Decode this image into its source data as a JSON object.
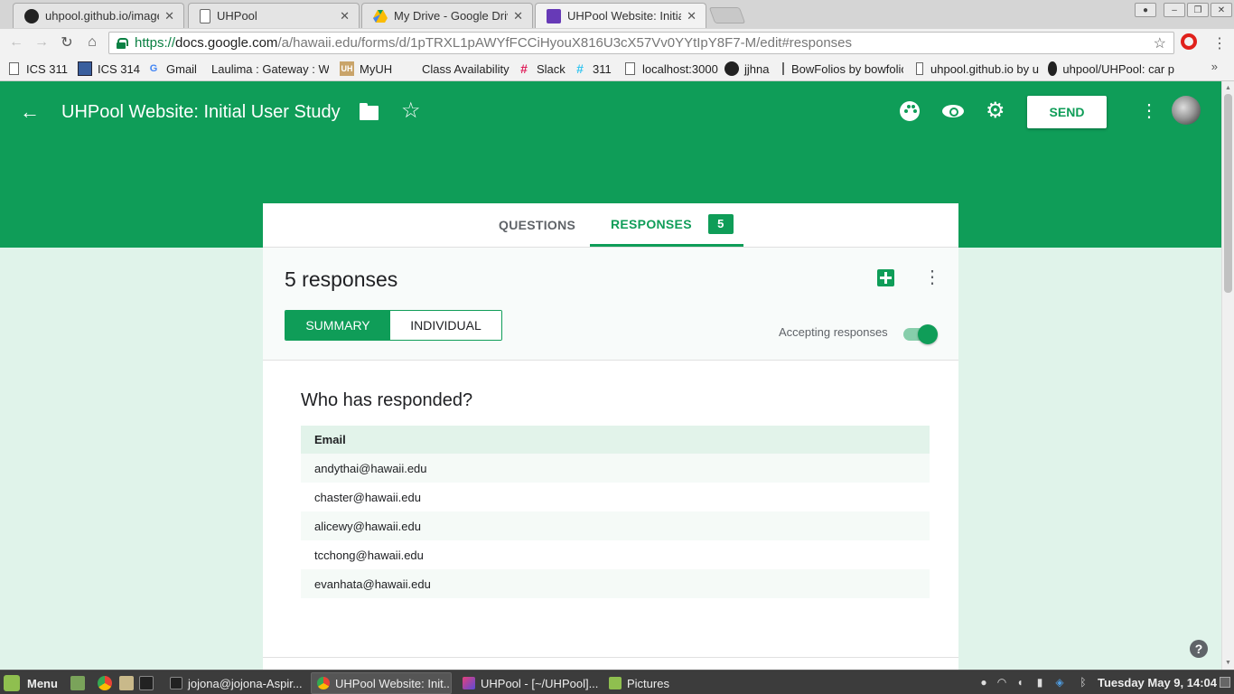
{
  "browser": {
    "tabs": [
      {
        "title": "uhpool.github.io/images/",
        "active": false
      },
      {
        "title": "UHPool",
        "active": false
      },
      {
        "title": "My Drive - Google Drive",
        "active": false
      },
      {
        "title": "UHPool Website: Initial User Study",
        "active": true
      }
    ],
    "close_glyph": "✕",
    "url": {
      "scheme": "https://",
      "host": "docs.google.com",
      "path": "/a/hawaii.edu/forms/d/1pTRXL1pAWYfFCCiHyouX816U3cX57Vv0YYtIpY8F7-M/edit#responses"
    },
    "bookmarks": [
      {
        "label": "ICS 311",
        "icon": "doc-icon"
      },
      {
        "label": "ICS 314",
        "icon": "square-icon"
      },
      {
        "label": "Gmail",
        "icon": "google-icon"
      },
      {
        "label": "Laulima : Gateway : W",
        "icon": "laulima-icon"
      },
      {
        "label": "MyUH",
        "icon": "uh-icon"
      },
      {
        "label": "Class Availability",
        "icon": "blank-icon"
      },
      {
        "label": "Slack",
        "icon": "slack-icon"
      },
      {
        "label": "311",
        "icon": "slack-icon"
      },
      {
        "label": "localhost:3000",
        "icon": "doc-icon"
      },
      {
        "label": "jjhna",
        "icon": "github-icon"
      },
      {
        "label": "BowFolios by bowfolio",
        "icon": "doc-icon"
      },
      {
        "label": "uhpool.github.io by u",
        "icon": "doc-icon"
      },
      {
        "label": "uhpool/UHPool: car p",
        "icon": "github-icon"
      }
    ],
    "bookmarks_overflow": "»"
  },
  "form": {
    "title": "UHPool Website: Initial User Study",
    "send_label": "SEND",
    "tabs": {
      "questions": "QUESTIONS",
      "responses": "RESPONSES",
      "response_count": "5"
    },
    "summary_title": "5 responses",
    "view_toggle": {
      "summary": "SUMMARY",
      "individual": "INDIVIDUAL"
    },
    "accepting_label": "Accepting responses",
    "accepting_on": true,
    "who_title": "Who has responded?",
    "table_header": "Email",
    "emails": [
      "andythai@hawaii.edu",
      "chaster@hawaii.edu",
      "alicewy@hawaii.edu",
      "tcchong@hawaii.edu",
      "evanhata@hawaii.edu"
    ],
    "accent_color": "#0f9d58"
  },
  "taskbar": {
    "menu_label": "Menu",
    "tasks": [
      {
        "label": "jojona@jojona-Aspir...",
        "active": false
      },
      {
        "label": "UHPool Website: Init...",
        "active": true
      },
      {
        "label": "UHPool - [~/UHPool]...",
        "active": false
      },
      {
        "label": "Pictures",
        "active": false
      }
    ],
    "clock": "Tuesday May 9, 14:04"
  }
}
